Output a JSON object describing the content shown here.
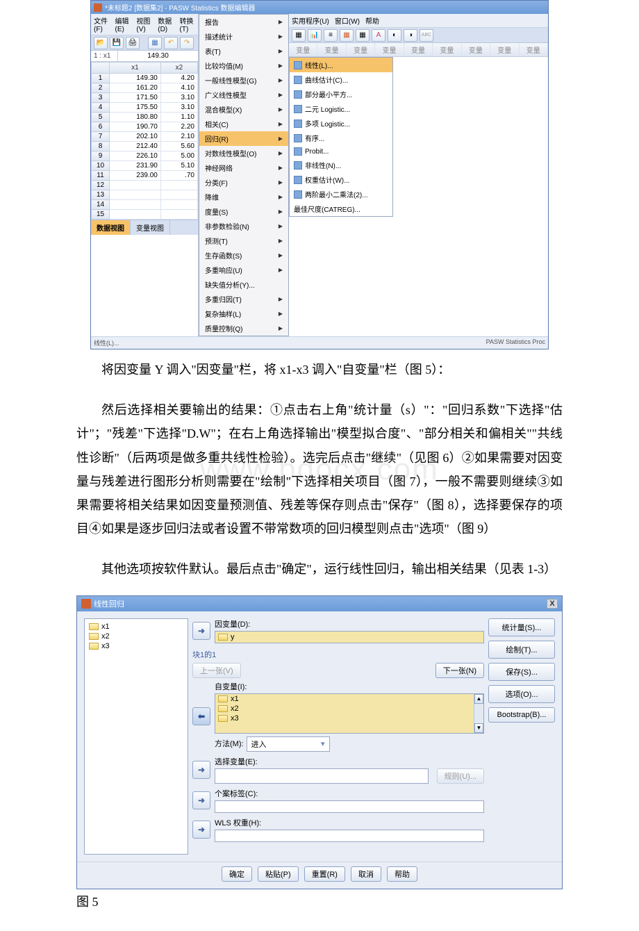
{
  "spss": {
    "title": "*未标题2 [数据集2] - PASW Statistics 数据编辑器",
    "menubar": {
      "file": "文件(F)",
      "edit": "编辑(E)",
      "view": "视图(V)",
      "data": "数据(D)",
      "transform": "转换(T)"
    },
    "menubar_r": {
      "util": "实用程序(U)",
      "win": "窗口(W)",
      "help": "帮助"
    },
    "cell_addr": "1 : x1",
    "cell_val": "149.30",
    "cols": {
      "c1": "x1",
      "c2": "x2"
    },
    "rows": [
      {
        "n": "1",
        "x1": "149.30",
        "x2": "4.20"
      },
      {
        "n": "2",
        "x1": "161.20",
        "x2": "4.10"
      },
      {
        "n": "3",
        "x1": "171.50",
        "x2": "3.10"
      },
      {
        "n": "4",
        "x1": "175.50",
        "x2": "3.10"
      },
      {
        "n": "5",
        "x1": "180.80",
        "x2": "1.10"
      },
      {
        "n": "6",
        "x1": "190.70",
        "x2": "2.20"
      },
      {
        "n": "7",
        "x1": "202.10",
        "x2": "2.10"
      },
      {
        "n": "8",
        "x1": "212.40",
        "x2": "5.60"
      },
      {
        "n": "9",
        "x1": "226.10",
        "x2": "5.00"
      },
      {
        "n": "10",
        "x1": "231.90",
        "x2": "5.10"
      },
      {
        "n": "11",
        "x1": "239.00",
        "x2": ".70"
      },
      {
        "n": "12",
        "x1": "",
        "x2": ""
      },
      {
        "n": "13",
        "x1": "",
        "x2": ""
      },
      {
        "n": "14",
        "x1": "",
        "x2": ""
      },
      {
        "n": "15",
        "x1": "",
        "x2": ""
      }
    ],
    "tabs": {
      "data": "数据视图",
      "var": "变量视图"
    },
    "status_l": "线性(L)...",
    "status_r": "PASW Statistics Proc",
    "analyze": [
      "报告",
      "描述统计",
      "表(T)",
      "比较均值(M)",
      "一般线性模型(G)",
      "广义线性模型",
      "混合模型(X)",
      "相关(C)",
      "回归(R)",
      "对数线性模型(O)",
      "神经网络",
      "分类(F)",
      "降维",
      "度量(S)",
      "非参数检验(N)",
      "预测(T)",
      "生存函数(S)",
      "多重响应(U)",
      "缺失值分析(Y)...",
      "多重归因(T)",
      "复杂抽样(L)",
      "质量控制(Q)"
    ],
    "submenu": [
      "线性(L)...",
      "曲线估计(C)...",
      "部分最小平方...",
      "二元 Logistic...",
      "多项 Logistic...",
      "有序...",
      "Probit...",
      "非线性(N)...",
      "权重估计(W)...",
      "两阶最小二乘法(2)...",
      "最佳尺度(CATREG)..."
    ],
    "emptycol": "变量"
  },
  "para1": "将因变量 Y 调入\"因变量\"栏，将 x1-x3 调入\"自变量\"栏（图 5）：",
  "para2": "然后选择相关要输出的结果：①点击右上角\"统计量（s）\"：\"回归系数\"下选择\"估计\"；\"残差\"下选择\"D.W\"；在右上角选择输出\"模型拟合度\"、\"部分相关和偏相关\"\"共线性诊断\"（后两项是做多重共线性检验）。选完后点击\"继续\"（见图 6）②如果需要对因变量与残差进行图形分析则需要在\"绘制\"下选择相关项目（图 7），一般不需要则继续③如果需要将相关结果如因变量预测值、残差等保存则点击\"保存\"（图 8），选择要保存的项目④如果是逐步回归法或者设置不带常数项的回归模型则点击\"选项\"（图 9）",
  "para3": "其他选项按软件默认。最后点击\"确定\"，运行线性回归，输出相关结果（见表 1-3）",
  "dlg": {
    "title": "线性回归",
    "close": "X",
    "vars": [
      "x1",
      "x2",
      "x3"
    ],
    "dep_lbl": "因变量(D):",
    "dep_val": "y",
    "block_lbl": "块1的1",
    "prev": "上一张(V)",
    "next": "下一张(N)",
    "indep_lbl": "自变量(I):",
    "indep": [
      "x1",
      "x2",
      "x3"
    ],
    "method_lbl": "方法(M):",
    "method_val": "进入",
    "selvar_lbl": "选择变量(E):",
    "rule": "规则(U)...",
    "case_lbl": "个案标签(C):",
    "wls_lbl": "WLS 权重(H):",
    "btns": {
      "ok": "确定",
      "paste": "粘贴(P)",
      "reset": "重置(R)",
      "cancel": "取消",
      "help": "帮助"
    },
    "right": {
      "stats": "统计量(S)...",
      "plots": "绘制(T)...",
      "save": "保存(S)...",
      "options": "选项(O)...",
      "boot": "Bootstrap(B)..."
    }
  },
  "caption": "图 5"
}
